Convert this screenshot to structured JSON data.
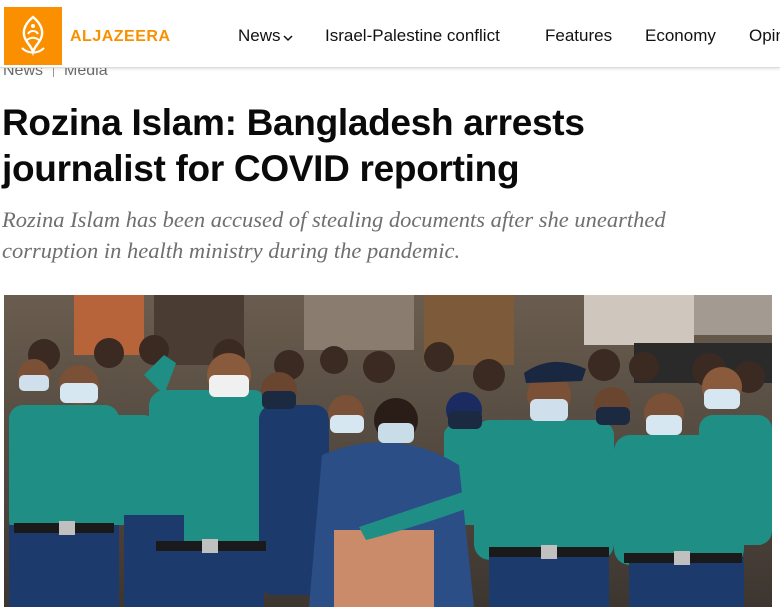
{
  "brand": {
    "name": "ALJAZEERA",
    "logo_color": "#fa9000",
    "logo_icon": "aljazeera-calligraphy-icon"
  },
  "nav": {
    "items": [
      {
        "label": "News",
        "has_dropdown": true
      },
      {
        "label": "Israel-Palestine conflict"
      },
      {
        "label": "Features"
      },
      {
        "label": "Economy"
      },
      {
        "label": "Opin"
      }
    ]
  },
  "breadcrumb": [
    "News",
    "Media"
  ],
  "article": {
    "headline": "Rozina Islam: Bangladesh arrests journalist for COVID reporting",
    "standfirst": "Rozina Islam has been accused of stealing documents after she unearthed corruption in health ministry during the pandemic."
  }
}
